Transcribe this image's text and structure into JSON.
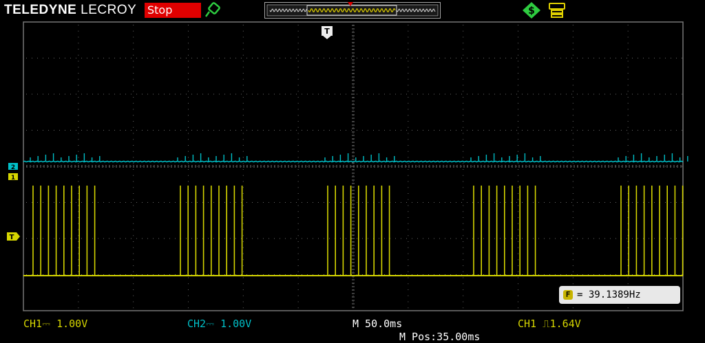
{
  "brand": {
    "bold": "TELEDYNE",
    "light": "LECROY"
  },
  "status": "Stop",
  "icons": {
    "probe": "probe-icon",
    "lock": "lock-icon",
    "usb": "usb-icon",
    "trigger": "trigger-marker-icon"
  },
  "markers": {
    "trigger_top": "T",
    "ch2": "2",
    "ch1": "1",
    "trigger_level": "T"
  },
  "measurement": {
    "prefix": "F",
    "text": "= 39.1389Hz"
  },
  "footer": {
    "ch1": "CH1⎓ 1.00V",
    "ch2": "CH2⎓ 1.00V",
    "timebase": "M 50.0ms",
    "trigger": "CH1 ⎍1.64V",
    "position": "M Pos:35.00ms"
  },
  "colors": {
    "ch1": "#d6d600",
    "ch2": "#00c0c8",
    "grid": "#606060",
    "status_bg": "#e00000",
    "background": "#000000"
  }
}
